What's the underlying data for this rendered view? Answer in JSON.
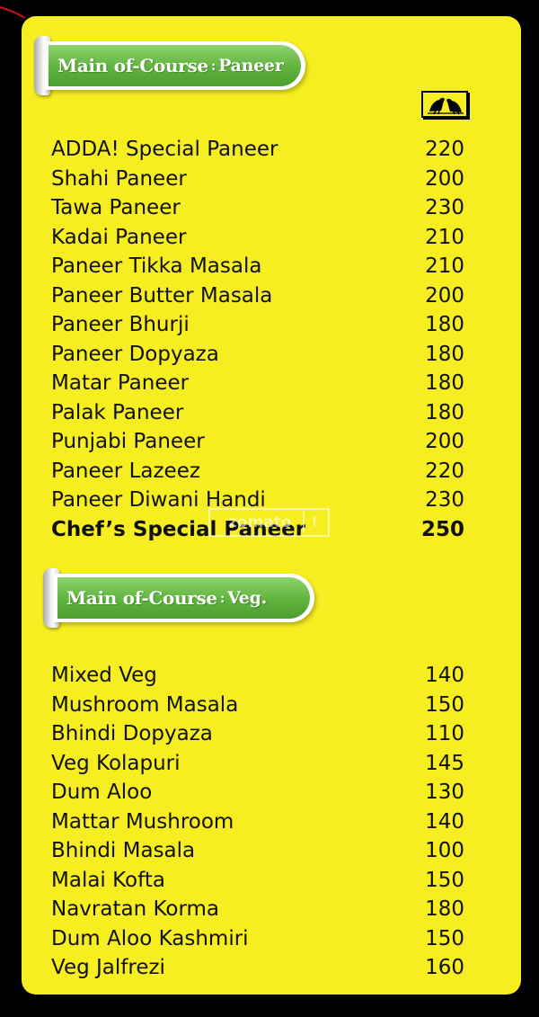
{
  "sections": [
    {
      "title": "Main of-Course",
      "subtitle": "Paneer",
      "items": [
        {
          "name": "ADDA! Special Paneer",
          "price": "220"
        },
        {
          "name": "Shahi Paneer",
          "price": "200"
        },
        {
          "name": "Tawa Paneer",
          "price": "230"
        },
        {
          "name": "Kadai Paneer",
          "price": "210"
        },
        {
          "name": "Paneer Tikka Masala",
          "price": "210"
        },
        {
          "name": "Paneer Butter Masala",
          "price": "200"
        },
        {
          "name": "Paneer Bhurji",
          "price": "180"
        },
        {
          "name": "Paneer Dopyaza",
          "price": "180"
        },
        {
          "name": "Matar Paneer",
          "price": "180"
        },
        {
          "name": "Palak Paneer",
          "price": "180"
        },
        {
          "name": "Punjabi Paneer",
          "price": "200"
        },
        {
          "name": "Paneer Lazeez",
          "price": "220"
        },
        {
          "name": "Paneer Diwani Handi",
          "price": "230"
        },
        {
          "name": "Chef’s Special Paneer",
          "price": "250",
          "highlight": true
        }
      ]
    },
    {
      "title": "Main of-Course",
      "subtitle": "Veg.",
      "items": [
        {
          "name": "Mixed Veg",
          "price": "140"
        },
        {
          "name": "Mushroom Masala",
          "price": "150"
        },
        {
          "name": "Bhindi Dopyaza",
          "price": "110"
        },
        {
          "name": "Veg Kolapuri",
          "price": "145"
        },
        {
          "name": "Dum Aloo",
          "price": "130"
        },
        {
          "name": "Mattar Mushroom",
          "price": "140"
        },
        {
          "name": "Bhindi Masala",
          "price": "100"
        },
        {
          "name": "Malai Kofta",
          "price": "150"
        },
        {
          "name": "Navratan Korma",
          "price": "180"
        },
        {
          "name": "Dum Aloo Kashmiri",
          "price": "150"
        },
        {
          "name": "Veg Jalfrezi",
          "price": "160"
        }
      ]
    }
  ],
  "watermark": {
    "text": "zomato",
    "mark": "!"
  },
  "icons": {
    "price_column_badge": "two-birds-icon"
  },
  "colors": {
    "background": "#f6ee20",
    "banner": "#5fb33d",
    "text": "#111111"
  }
}
